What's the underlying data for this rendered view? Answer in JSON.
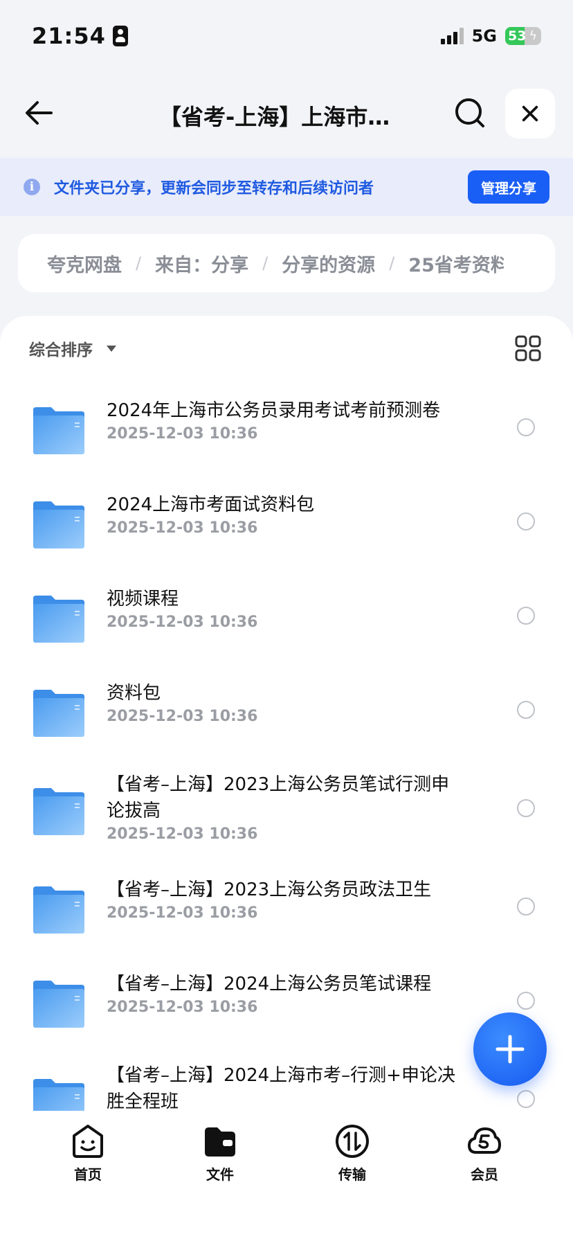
{
  "status_bar": {
    "time": "21:54",
    "network": "5G",
    "battery": "53",
    "battery_level": 53
  },
  "header": {
    "title": "【省考-上海】上海市…"
  },
  "notice": {
    "text": "文件夹已分享，更新会同步至转存和后续访问者",
    "manage_label": "管理分享",
    "info_glyph": "i"
  },
  "breadcrumb": [
    "夸克网盘",
    "来自：分享",
    "分享的资源",
    "25省考资料"
  ],
  "sort": {
    "label": "综合排序"
  },
  "files": [
    {
      "name": "2024年上海市公务员录用考试考前预测卷",
      "date": "2025-12-03 10:36"
    },
    {
      "name": "2024上海市考面试资料包",
      "date": "2025-12-03 10:36"
    },
    {
      "name": "视频课程",
      "date": "2025-12-03 10:36"
    },
    {
      "name": "资料包",
      "date": "2025-12-03 10:36"
    },
    {
      "name": "【省考–上海】2023上海公务员笔试行测申论拔高",
      "date": "2025-12-03 10:36"
    },
    {
      "name": "【省考–上海】2023上海公务员政法卫生",
      "date": "2025-12-03 10:36"
    },
    {
      "name": "【省考–上海】2024上海公务员笔试课程",
      "date": "2025-12-03 10:36"
    },
    {
      "name": "【省考–上海】2024上海市考–行测+申论决胜全程班",
      "date": ""
    }
  ],
  "nav": [
    {
      "label": "首页",
      "icon": "home-face-icon"
    },
    {
      "label": "文件",
      "icon": "folder-wallet-icon"
    },
    {
      "label": "传输",
      "icon": "transfer-icon"
    },
    {
      "label": "会员",
      "icon": "vip-cloud-icon"
    }
  ],
  "colors": {
    "accent": "#1a5ff5",
    "notice_bg": "#e8ecfb",
    "notice_text": "#1f5ae0",
    "folder": "#5aa6f2"
  }
}
